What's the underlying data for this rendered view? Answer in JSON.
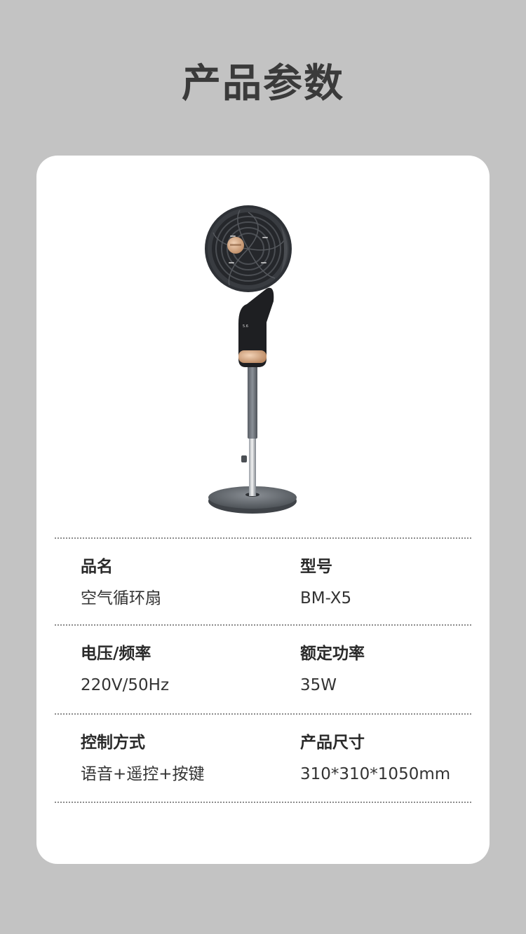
{
  "page": {
    "title": "产品参数"
  },
  "product": {
    "image_icon": "standing-air-circulator-fan",
    "brand_accent": "#c8916a"
  },
  "specs": [
    {
      "label": "品名",
      "value": "空气循环扇"
    },
    {
      "label": "型号",
      "value": "BM-X5"
    },
    {
      "label": "电压/频率",
      "value": "220V/50Hz"
    },
    {
      "label": "额定功率",
      "value": "35W"
    },
    {
      "label": "控制方式",
      "value": "语音+遥控+按键"
    },
    {
      "label": "产品尺寸",
      "value": "310*310*1050mm"
    }
  ]
}
